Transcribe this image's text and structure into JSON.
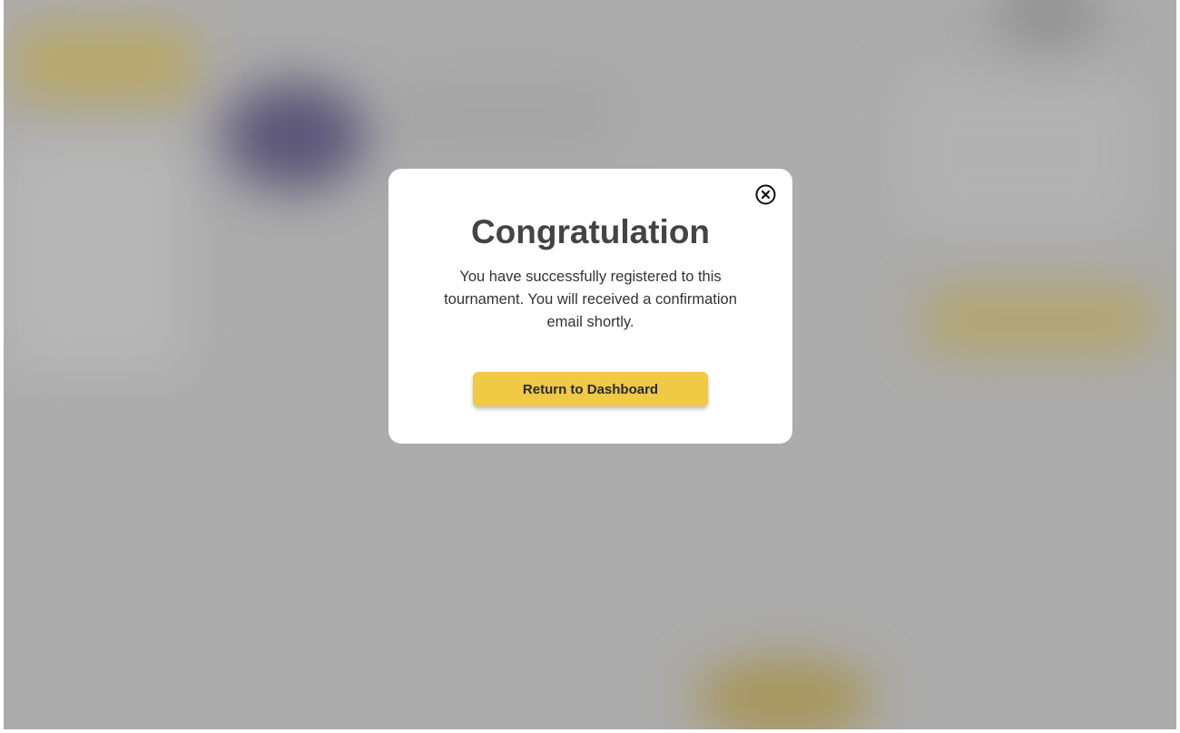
{
  "modal": {
    "title": "Congratulation",
    "message": "You have successfully registered to this tournament. You will received a confirmation email shortly.",
    "cta_label": "Return to Dashboard",
    "close_icon": "close-circle-icon"
  },
  "colors": {
    "accent": "#f0c945",
    "overlay": "#acacac",
    "title_text": "#444444"
  }
}
